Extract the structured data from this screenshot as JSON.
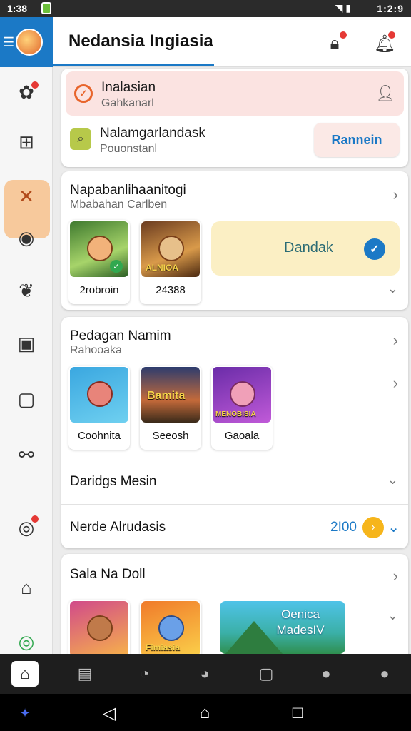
{
  "status_bar": {
    "time": "1:38",
    "clock_right": "1:2:9"
  },
  "app": {
    "title": "Nedansia Ingiasia"
  },
  "account_card": {
    "alert_title": "Inalasian",
    "alert_subtitle": "Gahkanarl",
    "row_title": "Nalamgarlandask",
    "row_subtitle": "Pouonstanl",
    "button_label": "Rannein"
  },
  "section1": {
    "title": "Napabanlihaanitogi",
    "subtitle": "Mbabahan Carlben",
    "tiles": [
      {
        "label": "2robroin",
        "caption": ""
      },
      {
        "label": "24388",
        "caption": "ALNIOA"
      }
    ],
    "promo_label": "Dandak"
  },
  "section2": {
    "title": "Pedagan Namim",
    "subtitle": "Rahooaka",
    "tiles": [
      {
        "label": "Coohnita",
        "caption": ""
      },
      {
        "label": "Seeosh",
        "caption": "Bamita"
      },
      {
        "label": "Gaoala",
        "caption": "MENOBISIA"
      }
    ],
    "row1_label": "Daridgs Mesin",
    "row2_label": "Nerde Alrudasis",
    "row2_count": "2I00"
  },
  "section3": {
    "title": "Sala Na Doll",
    "tiles": [
      {
        "label": "",
        "caption": ""
      },
      {
        "label": "",
        "caption": "Fimiasia"
      }
    ],
    "promo_label": "Oenica MadesIV"
  },
  "colors": {
    "accent": "#1b79c6",
    "alert_bg": "#fbe3e1",
    "promo_bg": "#fbefc4",
    "coin": "#f6b51b"
  }
}
